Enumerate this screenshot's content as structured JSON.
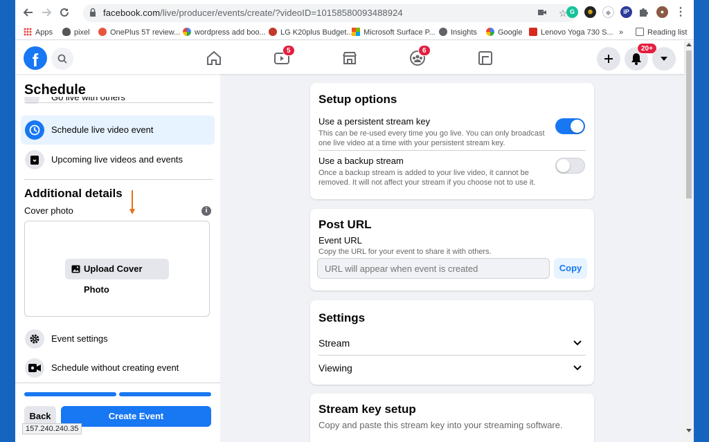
{
  "browser": {
    "url_host": "facebook.com",
    "url_path": "/live/producer/events/create/?videoID=10158580093488924",
    "bookmarks": [
      {
        "label": "Apps",
        "icon": "apps-grid-icon"
      },
      {
        "label": "pixel",
        "icon": "apple-icon"
      },
      {
        "label": "OnePlus 5T review...",
        "icon": "site-icon"
      },
      {
        "label": "wordpress add boo...",
        "icon": "google-icon"
      },
      {
        "label": "LG K20plus Budget...",
        "icon": "site-icon"
      },
      {
        "label": "Microsoft Surface P...",
        "icon": "microsoft-icon"
      },
      {
        "label": "Insights",
        "icon": "globe-icon"
      },
      {
        "label": "Google",
        "icon": "google-icon"
      },
      {
        "label": "Lenovo Yoga 730 S...",
        "icon": "cnet-icon"
      }
    ],
    "more_bookmarks": "»",
    "reading_list": "Reading list",
    "status_url": "157.240.240.35"
  },
  "fb_header": {
    "logo": "f",
    "watch_badge": "5",
    "groups_badge": "6",
    "notifications_badge": "20+"
  },
  "left": {
    "title": "Schedule",
    "partial_item": "Go live with others",
    "items": [
      {
        "label": "Schedule live video event"
      },
      {
        "label": "Upcoming live videos and events"
      }
    ],
    "additional_title": "Additional details",
    "cover_label": "Cover photo",
    "upload_label": "Upload Cover Photo",
    "event_settings": "Event settings",
    "schedule_without": "Schedule without creating event",
    "back_label": "Back",
    "create_label": "Create Event",
    "progress": [
      1,
      1
    ]
  },
  "setup": {
    "title": "Setup options",
    "persistent_title": "Use a persistent stream key",
    "persistent_desc": "This can be re-used every time you go live. You can only broadcast one live video at a time with your persistent stream key.",
    "persistent_on": true,
    "backup_title": "Use a backup stream",
    "backup_desc": "Once a backup stream is added to your live video, it cannot be removed. It will not affect your stream if you choose not to use it.",
    "backup_on": false
  },
  "post_url": {
    "title": "Post URL",
    "event_url_label": "Event URL",
    "desc": "Copy the URL for your event to share it with others.",
    "placeholder": "URL will appear when event is created",
    "copy_label": "Copy"
  },
  "settings": {
    "title": "Settings",
    "stream": "Stream",
    "viewing": "Viewing"
  },
  "stream_key": {
    "title": "Stream key setup",
    "desc": "Copy and paste this stream key into your streaming software."
  },
  "colors": {
    "brand": "#1877f2",
    "badge": "#e41e3f",
    "active_bg": "#e7f3ff"
  }
}
